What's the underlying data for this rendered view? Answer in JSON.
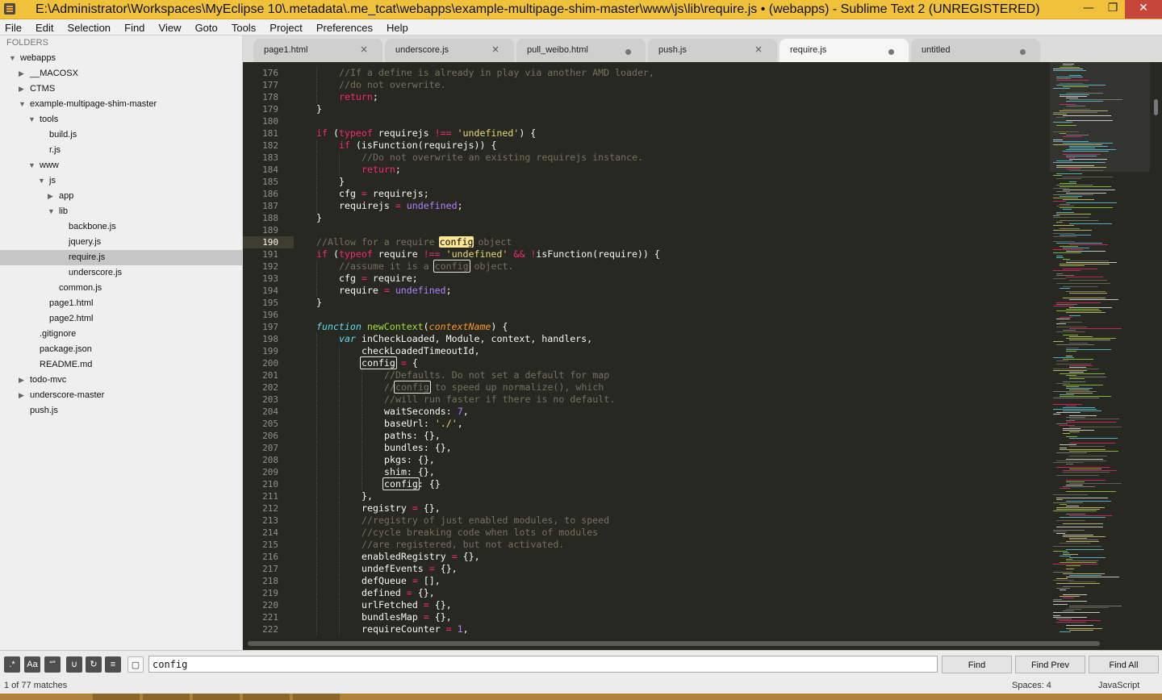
{
  "window": {
    "title": "E:\\Administrator\\Workspaces\\MyEclipse 10\\.metadata\\.me_tcat\\webapps\\example-multipage-shim-master\\www\\js\\lib\\require.js • (webapps) - Sublime Text 2 (UNREGISTERED)",
    "minimize": "—",
    "restore": "❐",
    "close": "✕"
  },
  "menu": [
    "File",
    "Edit",
    "Selection",
    "Find",
    "View",
    "Goto",
    "Tools",
    "Project",
    "Preferences",
    "Help"
  ],
  "sidebar": {
    "header": "FOLDERS",
    "tree": [
      {
        "label": "webapps",
        "depth": 0,
        "arrow": "▼"
      },
      {
        "label": "__MACOSX",
        "depth": 1,
        "arrow": "▶"
      },
      {
        "label": "CTMS",
        "depth": 1,
        "arrow": "▶"
      },
      {
        "label": "example-multipage-shim-master",
        "depth": 1,
        "arrow": "▼"
      },
      {
        "label": "tools",
        "depth": 2,
        "arrow": "▼"
      },
      {
        "label": "build.js",
        "depth": 3,
        "arrow": ""
      },
      {
        "label": "r.js",
        "depth": 3,
        "arrow": ""
      },
      {
        "label": "www",
        "depth": 2,
        "arrow": "▼"
      },
      {
        "label": "js",
        "depth": 3,
        "arrow": "▼"
      },
      {
        "label": "app",
        "depth": 4,
        "arrow": "▶"
      },
      {
        "label": "lib",
        "depth": 4,
        "arrow": "▼"
      },
      {
        "label": "backbone.js",
        "depth": 5,
        "arrow": ""
      },
      {
        "label": "jquery.js",
        "depth": 5,
        "arrow": ""
      },
      {
        "label": "require.js",
        "depth": 5,
        "arrow": "",
        "selected": true
      },
      {
        "label": "underscore.js",
        "depth": 5,
        "arrow": ""
      },
      {
        "label": "common.js",
        "depth": 4,
        "arrow": ""
      },
      {
        "label": "page1.html",
        "depth": 3,
        "arrow": ""
      },
      {
        "label": "page2.html",
        "depth": 3,
        "arrow": ""
      },
      {
        "label": ".gitignore",
        "depth": 2,
        "arrow": ""
      },
      {
        "label": "package.json",
        "depth": 2,
        "arrow": ""
      },
      {
        "label": "README.md",
        "depth": 2,
        "arrow": ""
      },
      {
        "label": "todo-mvc",
        "depth": 1,
        "arrow": "▶"
      },
      {
        "label": "underscore-master",
        "depth": 1,
        "arrow": "▶"
      },
      {
        "label": "push.js",
        "depth": 1,
        "arrow": ""
      }
    ]
  },
  "tabs": [
    {
      "label": "page1.html",
      "marker": "close"
    },
    {
      "label": "underscore.js",
      "marker": "close"
    },
    {
      "label": "pull_weibo.html",
      "marker": "dirty"
    },
    {
      "label": "push.js",
      "marker": "close"
    },
    {
      "label": "require.js",
      "marker": "dirty",
      "active": true
    },
    {
      "label": "untitled",
      "marker": "dirty"
    }
  ],
  "editor": {
    "current_line": 190,
    "lines": [
      {
        "n": 176,
        "indent": 3,
        "tokens": [
          [
            "c",
            "//If a define is already in play via another AMD loader,"
          ]
        ]
      },
      {
        "n": 177,
        "indent": 3,
        "tokens": [
          [
            "c",
            "//do not overwrite."
          ]
        ]
      },
      {
        "n": 178,
        "indent": 3,
        "tokens": [
          [
            "k",
            "return"
          ],
          [
            "",
            "; "
          ]
        ]
      },
      {
        "n": 179,
        "indent": 2,
        "tokens": [
          [
            "",
            "}"
          ]
        ]
      },
      {
        "n": 180,
        "indent": 0,
        "tokens": []
      },
      {
        "n": 181,
        "indent": 2,
        "tokens": [
          [
            "k",
            "if"
          ],
          [
            "",
            " ("
          ],
          [
            "k",
            "typeof"
          ],
          [
            "",
            " requirejs "
          ],
          [
            "o",
            "!=="
          ],
          [
            "",
            " "
          ],
          [
            "s",
            "'undefined'"
          ],
          [
            "",
            ") {"
          ]
        ]
      },
      {
        "n": 182,
        "indent": 3,
        "tokens": [
          [
            "k",
            "if"
          ],
          [
            "",
            " (isFunction(requirejs)) {"
          ]
        ]
      },
      {
        "n": 183,
        "indent": 4,
        "tokens": [
          [
            "c",
            "//Do not overwrite an existing requirejs instance."
          ]
        ]
      },
      {
        "n": 184,
        "indent": 4,
        "tokens": [
          [
            "k",
            "return"
          ],
          [
            "",
            ";"
          ]
        ]
      },
      {
        "n": 185,
        "indent": 3,
        "tokens": [
          [
            "",
            "}"
          ]
        ]
      },
      {
        "n": 186,
        "indent": 3,
        "tokens": [
          [
            "",
            "cfg "
          ],
          [
            "o",
            "="
          ],
          [
            "",
            " requirejs;"
          ]
        ]
      },
      {
        "n": 187,
        "indent": 3,
        "tokens": [
          [
            "",
            "requirejs "
          ],
          [
            "o",
            "="
          ],
          [
            "",
            " "
          ],
          [
            "t2",
            "undefined"
          ],
          [
            "",
            ";"
          ]
        ]
      },
      {
        "n": 188,
        "indent": 2,
        "tokens": [
          [
            "",
            "}"
          ]
        ]
      },
      {
        "n": 189,
        "indent": 0,
        "tokens": []
      },
      {
        "n": 190,
        "indent": 2,
        "tokens": [
          [
            "c",
            "//Allow for a require "
          ],
          [
            "hlsel",
            "config"
          ],
          [
            "c",
            " object"
          ]
        ]
      },
      {
        "n": 191,
        "indent": 2,
        "tokens": [
          [
            "k",
            "if"
          ],
          [
            "",
            " ("
          ],
          [
            "k",
            "typeof"
          ],
          [
            "",
            " require "
          ],
          [
            "o",
            "!=="
          ],
          [
            "",
            " "
          ],
          [
            "s",
            "'undefined'"
          ],
          [
            "",
            " "
          ],
          [
            "o",
            "&&"
          ],
          [
            "",
            " "
          ],
          [
            "o",
            "!"
          ],
          [
            "",
            "isFunction(require)) {"
          ]
        ]
      },
      {
        "n": 192,
        "indent": 3,
        "tokens": [
          [
            "c",
            "//assume it is a "
          ],
          [
            "hlc",
            "config"
          ],
          [
            "c",
            " object."
          ]
        ]
      },
      {
        "n": 193,
        "indent": 3,
        "tokens": [
          [
            "",
            "cfg "
          ],
          [
            "o",
            "="
          ],
          [
            "",
            " require;"
          ]
        ]
      },
      {
        "n": 194,
        "indent": 3,
        "tokens": [
          [
            "",
            "require "
          ],
          [
            "o",
            "="
          ],
          [
            "",
            " "
          ],
          [
            "t2",
            "undefined"
          ],
          [
            "",
            ";"
          ]
        ]
      },
      {
        "n": 195,
        "indent": 2,
        "tokens": [
          [
            "",
            "}"
          ]
        ]
      },
      {
        "n": 196,
        "indent": 0,
        "tokens": []
      },
      {
        "n": 197,
        "indent": 2,
        "tokens": [
          [
            "t",
            "function"
          ],
          [
            "",
            " "
          ],
          [
            "f",
            "newContext"
          ],
          [
            "",
            "("
          ],
          [
            "p",
            "contextName"
          ],
          [
            "",
            ") {"
          ]
        ]
      },
      {
        "n": 198,
        "indent": 3,
        "tokens": [
          [
            "t",
            "var"
          ],
          [
            "",
            " inCheckLoaded, Module, context, handlers,"
          ]
        ]
      },
      {
        "n": 199,
        "indent": 4,
        "tokens": [
          [
            "",
            "checkLoadedTimeoutId,"
          ]
        ]
      },
      {
        "n": 200,
        "indent": 4,
        "tokens": [
          [
            "hl",
            "config"
          ],
          [
            "",
            " "
          ],
          [
            "o",
            "="
          ],
          [
            "",
            " {"
          ]
        ]
      },
      {
        "n": 201,
        "indent": 5,
        "tokens": [
          [
            "c",
            "//Defaults. Do not set a default for map"
          ]
        ]
      },
      {
        "n": 202,
        "indent": 5,
        "tokens": [
          [
            "c",
            "//"
          ],
          [
            "hlc",
            "config"
          ],
          [
            "c",
            " to speed up normalize(), which"
          ]
        ]
      },
      {
        "n": 203,
        "indent": 5,
        "tokens": [
          [
            "c",
            "//will run faster if there is no default."
          ]
        ]
      },
      {
        "n": 204,
        "indent": 5,
        "tokens": [
          [
            "",
            "waitSeconds: "
          ],
          [
            "n",
            "7"
          ],
          [
            "",
            ","
          ]
        ]
      },
      {
        "n": 205,
        "indent": 5,
        "tokens": [
          [
            "",
            "baseUrl: "
          ],
          [
            "s",
            "'./'"
          ],
          [
            "",
            ","
          ]
        ]
      },
      {
        "n": 206,
        "indent": 5,
        "tokens": [
          [
            "",
            "paths: {},"
          ]
        ]
      },
      {
        "n": 207,
        "indent": 5,
        "tokens": [
          [
            "",
            "bundles: {},"
          ]
        ]
      },
      {
        "n": 208,
        "indent": 5,
        "tokens": [
          [
            "",
            "pkgs: {},"
          ]
        ]
      },
      {
        "n": 209,
        "indent": 5,
        "tokens": [
          [
            "",
            "shim: {},"
          ]
        ]
      },
      {
        "n": 210,
        "indent": 5,
        "tokens": [
          [
            "hl",
            "config"
          ],
          [
            "",
            ": {}"
          ]
        ]
      },
      {
        "n": 211,
        "indent": 4,
        "tokens": [
          [
            "",
            "},"
          ]
        ]
      },
      {
        "n": 212,
        "indent": 4,
        "tokens": [
          [
            "",
            "registry "
          ],
          [
            "o",
            "="
          ],
          [
            "",
            " {},"
          ]
        ]
      },
      {
        "n": 213,
        "indent": 4,
        "tokens": [
          [
            "c",
            "//registry of just enabled modules, to speed"
          ]
        ]
      },
      {
        "n": 214,
        "indent": 4,
        "tokens": [
          [
            "c",
            "//cycle breaking code when lots of modules"
          ]
        ]
      },
      {
        "n": 215,
        "indent": 4,
        "tokens": [
          [
            "c",
            "//are registered, but not activated."
          ]
        ]
      },
      {
        "n": 216,
        "indent": 4,
        "tokens": [
          [
            "",
            "enabledRegistry "
          ],
          [
            "o",
            "="
          ],
          [
            "",
            " {},"
          ]
        ]
      },
      {
        "n": 217,
        "indent": 4,
        "tokens": [
          [
            "",
            "undefEvents "
          ],
          [
            "o",
            "="
          ],
          [
            "",
            " {},"
          ]
        ]
      },
      {
        "n": 218,
        "indent": 4,
        "tokens": [
          [
            "",
            "defQueue "
          ],
          [
            "o",
            "="
          ],
          [
            "",
            " [],"
          ]
        ]
      },
      {
        "n": 219,
        "indent": 4,
        "tokens": [
          [
            "",
            "defined "
          ],
          [
            "o",
            "="
          ],
          [
            "",
            " {},"
          ]
        ]
      },
      {
        "n": 220,
        "indent": 4,
        "tokens": [
          [
            "",
            "urlFetched "
          ],
          [
            "o",
            "="
          ],
          [
            "",
            " {},"
          ]
        ]
      },
      {
        "n": 221,
        "indent": 4,
        "tokens": [
          [
            "",
            "bundlesMap "
          ],
          [
            "o",
            "="
          ],
          [
            "",
            " {},"
          ]
        ]
      },
      {
        "n": 222,
        "indent": 4,
        "tokens": [
          [
            "",
            "requireCounter "
          ],
          [
            "o",
            "="
          ],
          [
            "",
            " "
          ],
          [
            "n",
            "1"
          ],
          [
            "",
            ","
          ]
        ]
      }
    ]
  },
  "findbar": {
    "options": [
      ".*",
      "Aa",
      "“”",
      "∪",
      "↻",
      "≡",
      "▢"
    ],
    "query": "config",
    "find": "Find",
    "find_prev": "Find Prev",
    "find_all": "Find All"
  },
  "status": {
    "matches": "1 of 77 matches",
    "spaces": "Spaces: 4",
    "syntax": "JavaScript"
  },
  "colors": {
    "editor_bg": "#272822",
    "keyword": "#f92672",
    "string": "#e6db74",
    "comment": "#75715e",
    "storage": "#66d9ef",
    "function": "#a6e22e",
    "param": "#fd971f",
    "number": "#ae81ff",
    "find_highlight": "#ffe792",
    "titlebar": "#f0c23c"
  }
}
